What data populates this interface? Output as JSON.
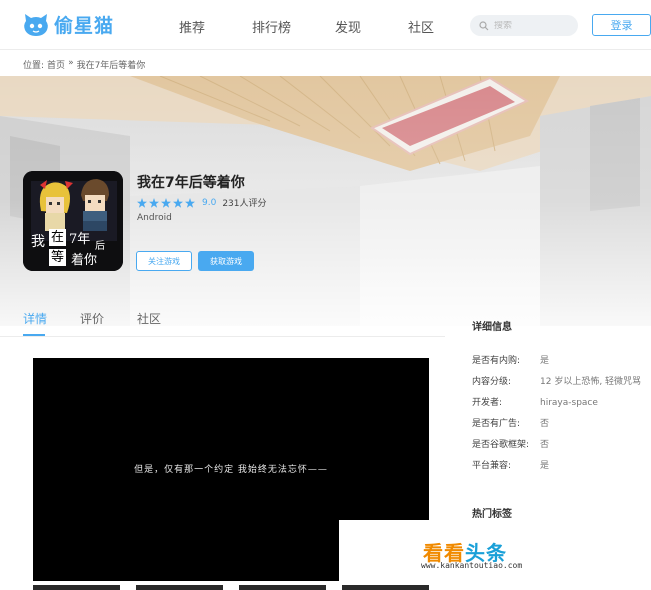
{
  "header": {
    "logo_text": "偷星猫",
    "nav": [
      "推荐",
      "排行榜",
      "发现",
      "社区"
    ],
    "search_placeholder": "搜索",
    "login_label": "登录"
  },
  "breadcrumb": {
    "prefix": "位置:",
    "home": "首页",
    "sep": "»",
    "current": "我在7年后等着你"
  },
  "app": {
    "title": "我在7年后等着你",
    "score": "9.0",
    "reviews": "231人评分",
    "platform": "Android",
    "follow_label": "关注游戏",
    "get_label": "获取游戏",
    "icon_text_1": "我",
    "icon_text_2": "在",
    "icon_text_3": "7年",
    "icon_text_4": "后",
    "icon_text_5": "等",
    "icon_text_6": "着你",
    "stars_filled": 5,
    "accent_color": "#49a9f0"
  },
  "tabs": [
    "详情",
    "评价",
    "社区"
  ],
  "video": {
    "subtitle": "但是，仅有那一个约定 我始终无法忘怀——"
  },
  "details": {
    "title": "详细信息",
    "rows": [
      {
        "k": "是否有内购:",
        "v": "是"
      },
      {
        "k": "内容分级:",
        "v": "12 岁以上恐怖, 轻微咒骂"
      },
      {
        "k": "开发者:",
        "v": "hiraya-space"
      },
      {
        "k": "是否有广告:",
        "v": "否"
      },
      {
        "k": "是否谷歌框架:",
        "v": "否"
      },
      {
        "k": "平台兼容:",
        "v": "是"
      }
    ],
    "hot_tags_title": "热门标签"
  },
  "watermark": {
    "text_a": "看看",
    "text_b": "头条",
    "url": "www.kankantoutiao.com"
  }
}
